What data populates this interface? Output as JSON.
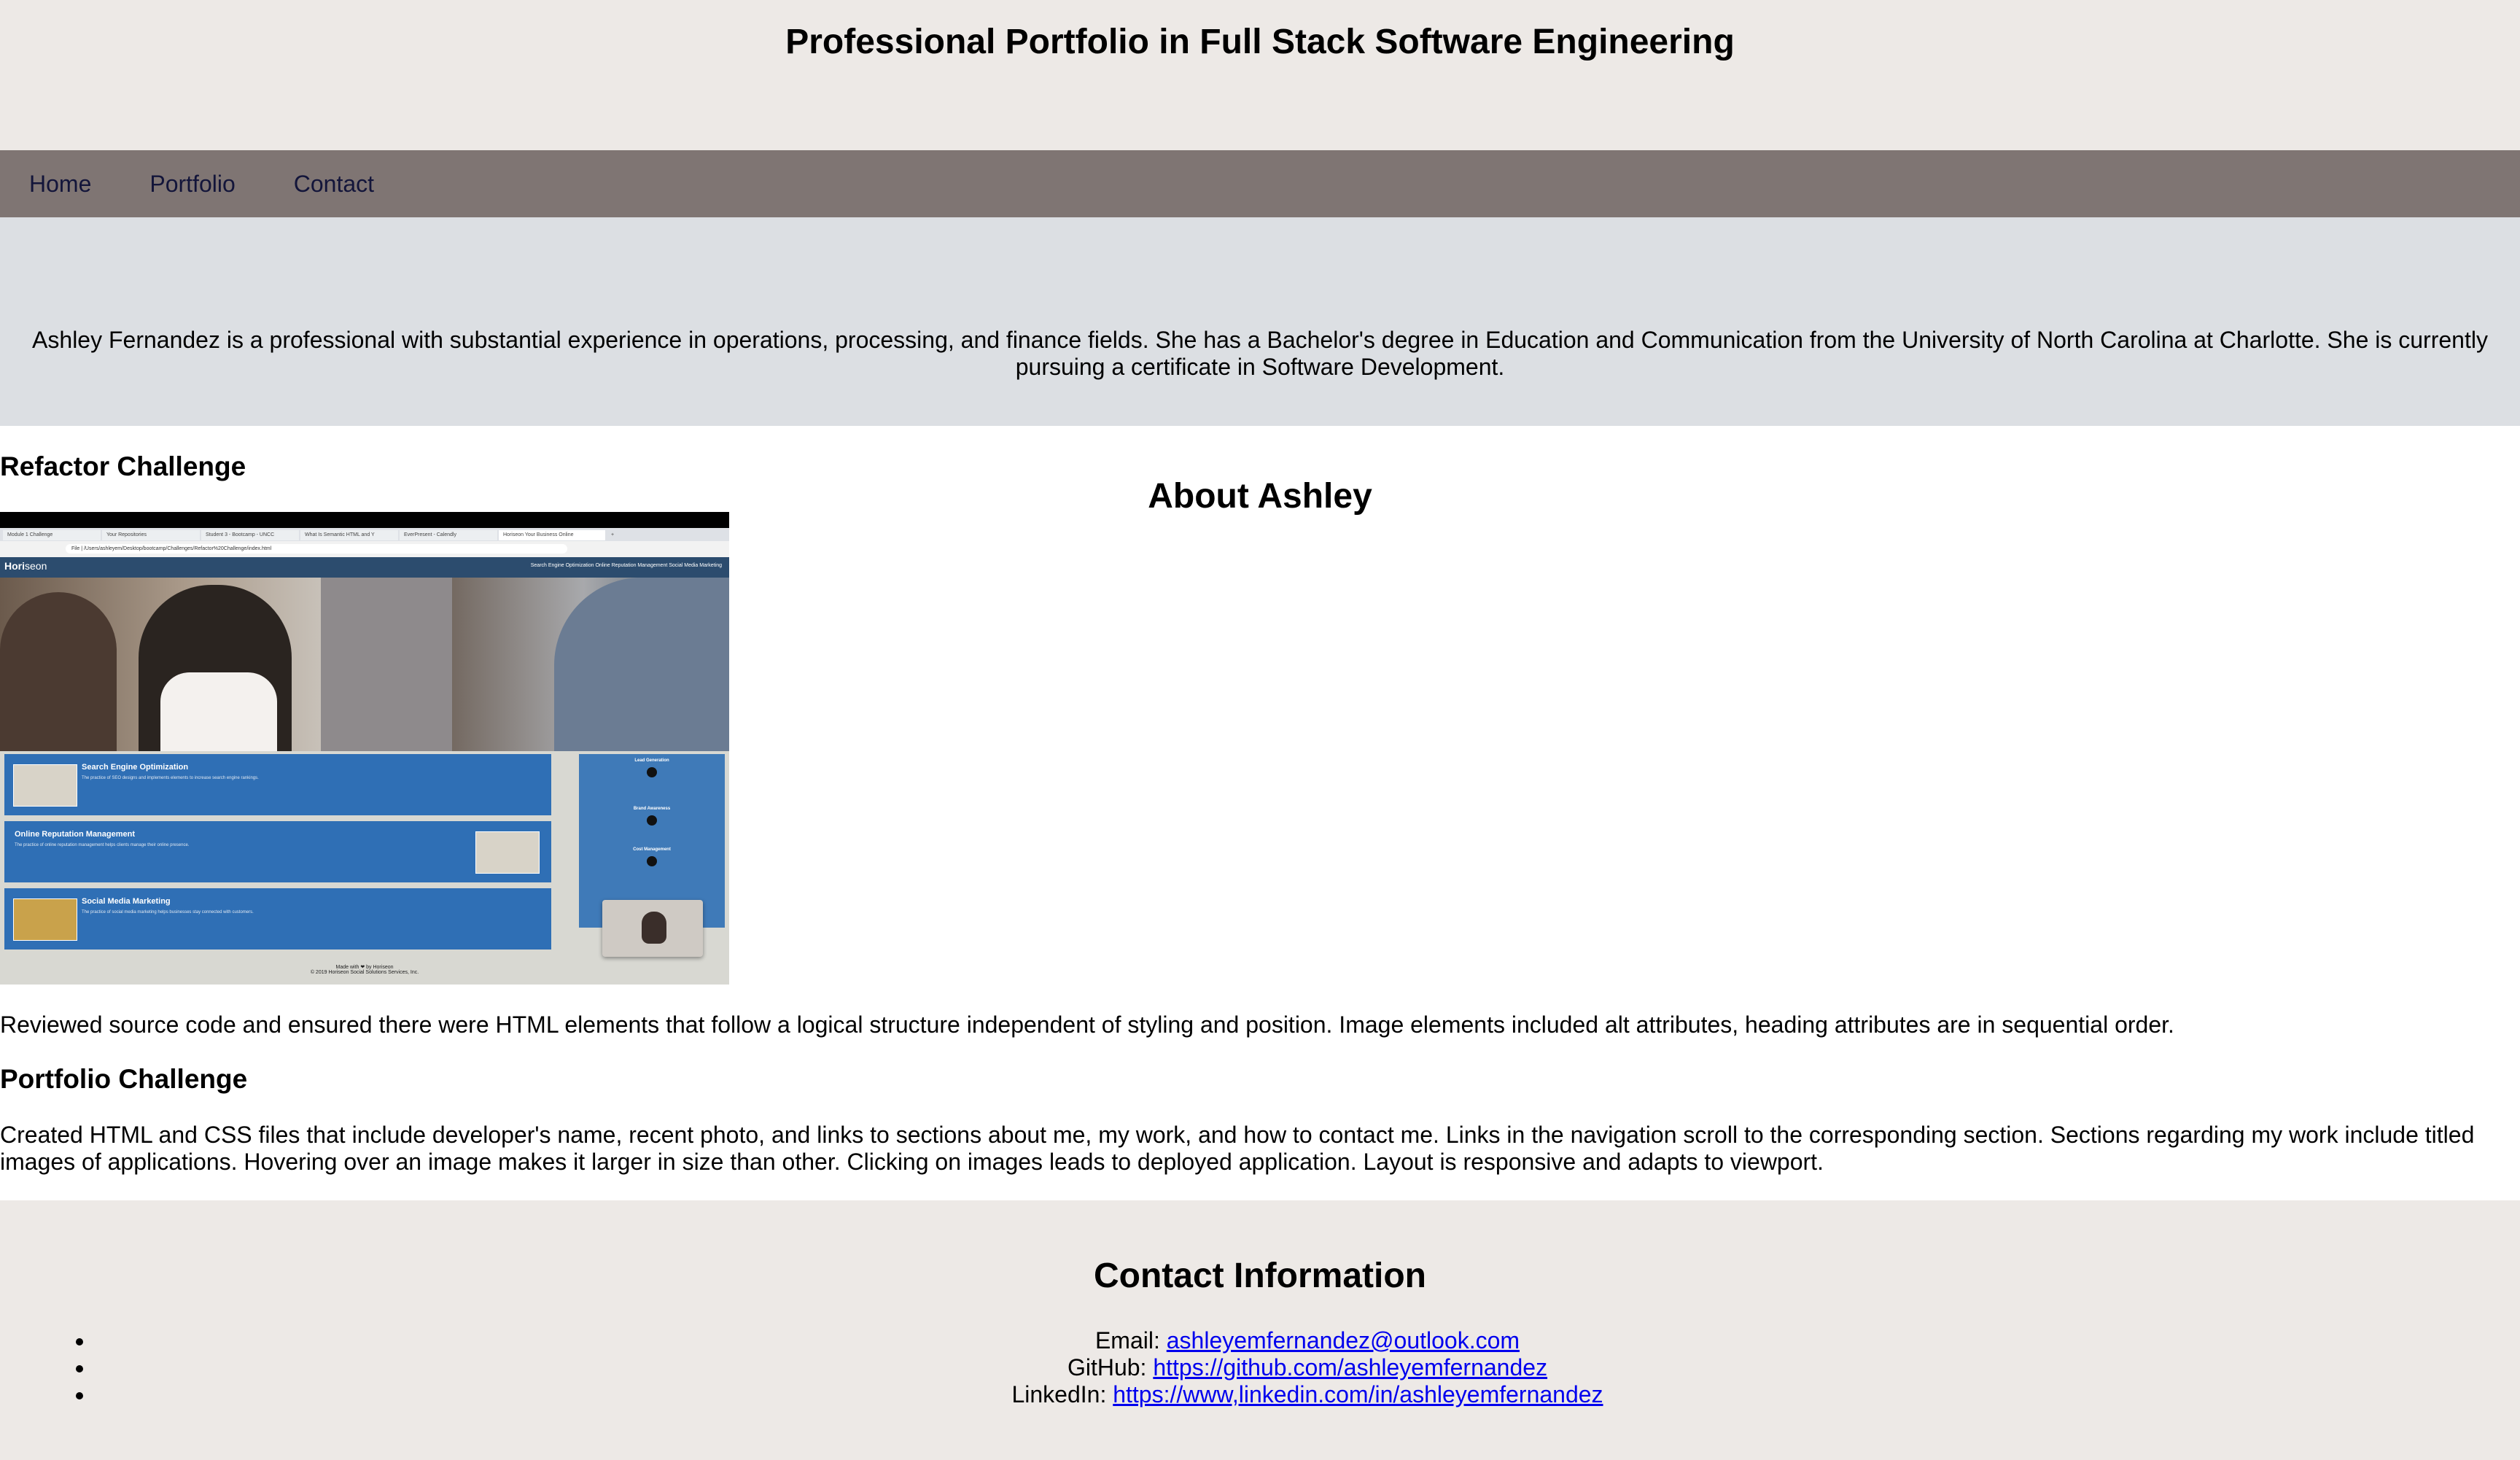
{
  "header": {
    "title": "Professional Portfolio in Full Stack Software Engineering"
  },
  "nav": {
    "items": [
      {
        "label": "Home"
      },
      {
        "label": "Portfolio"
      },
      {
        "label": "Contact"
      }
    ]
  },
  "about": {
    "title": "About Ashley",
    "text": "Ashley Fernandez is a professional with substantial experience in operations, processing, and finance fields. She has a Bachelor's degree in Education and Communication from the University of North Carolina at Charlotte. She is currently pursuing a certificate in Software Development."
  },
  "work": {
    "refactor": {
      "title": "Refactor Challenge",
      "description": "Reviewed source code and ensured there were HTML elements that follow a logical structure independent of styling and position. Image elements included alt attributes, heading attributes are in sequential order.",
      "screenshot": {
        "tabs": [
          "Module 1 Challenge",
          "Your Repositories",
          "Student 3 - Bootcamp - UNCC",
          "What Is Semantic HTML and Y",
          "EverPresent - Calendly",
          "Horiseon Your Business Online",
          "+"
        ],
        "url": "File | /Users/ashleyem/Desktop/bootcamp/Challenges/Refactor%20Challenge/index.html",
        "brand": "Hori",
        "brand_accent": "seon",
        "brand_links": "Search Engine Optimization   Online Reputation Management   Social Media Marketing",
        "cards": [
          {
            "title": "Search Engine Optimization",
            "text": "The practice of SEO designs and implements elements to increase search engine rankings."
          },
          {
            "title": "Online Reputation Management",
            "text": "The practice of online reputation management helps clients manage their online presence."
          },
          {
            "title": "Social Media Marketing",
            "text": "The practice of social media marketing helps businesses stay connected with customers."
          }
        ],
        "side": [
          "Lead Generation",
          "Brand Awareness",
          "Cost Management"
        ],
        "footer1": "Made with ❤ by Horiseon",
        "footer2": "© 2019 Horiseon Social Solutions Services, Inc."
      }
    },
    "portfolio": {
      "title": "Portfolio Challenge",
      "description": "Created HTML and CSS files that include developer's name, recent photo, and links to sections about me, my work, and how to contact me. Links in the navigation scroll to the corresponding section. Sections regarding my work include titled images of applications. Hovering over an image makes it larger in size than other. Clicking on images leads to deployed application. Layout is responsive and adapts to viewport."
    }
  },
  "contact": {
    "title": "Contact Information",
    "items": [
      {
        "label": "Email: ",
        "link": "ashleyemfernandez@outlook.com"
      },
      {
        "label": "GitHub: ",
        "link": "https://github.com/ashleyemfernandez"
      },
      {
        "label": "LinkedIn: ",
        "link": "https://www,linkedin.com/in/ashleyemfernandez"
      }
    ]
  },
  "colors": {
    "header_bg": "#ede9e6",
    "nav_bg": "#7f7573",
    "about_bg": "#dcdfe3",
    "link": "#0000ee"
  }
}
